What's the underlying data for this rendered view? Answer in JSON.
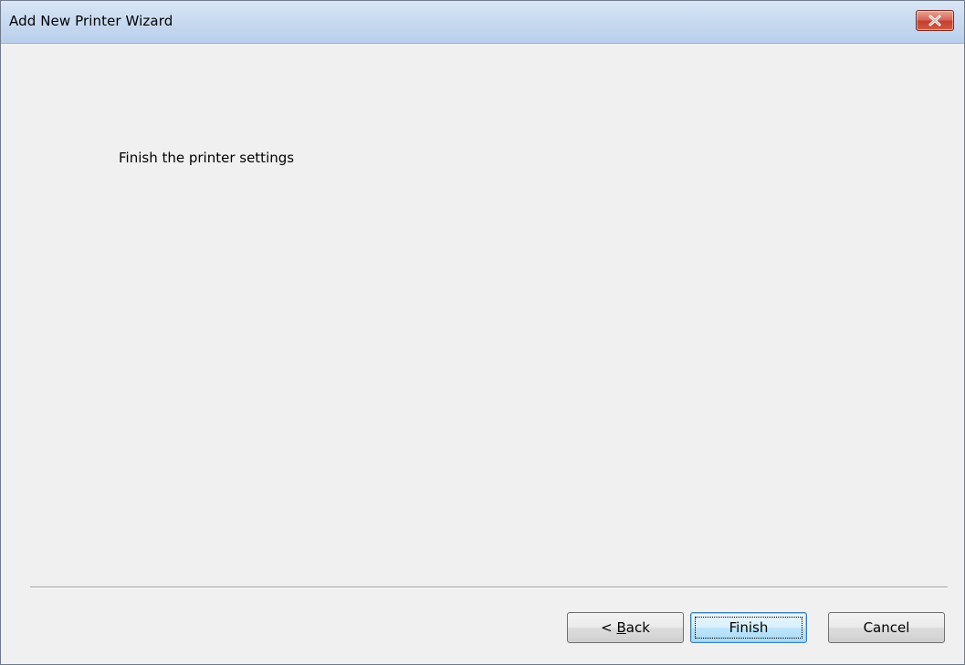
{
  "window": {
    "title": "Add New Printer Wizard",
    "close_icon": "close-x-icon"
  },
  "main": {
    "heading": "Finish the printer settings"
  },
  "buttons": {
    "back_prefix": "< ",
    "back_accel": "B",
    "back_rest": "ack",
    "finish": "Finish",
    "cancel": "Cancel"
  },
  "colors": {
    "titlebar": "#c9dbf1",
    "close_button": "#c3402e",
    "default_button_border": "#3c7fb1",
    "background": "#f0f0f0"
  }
}
